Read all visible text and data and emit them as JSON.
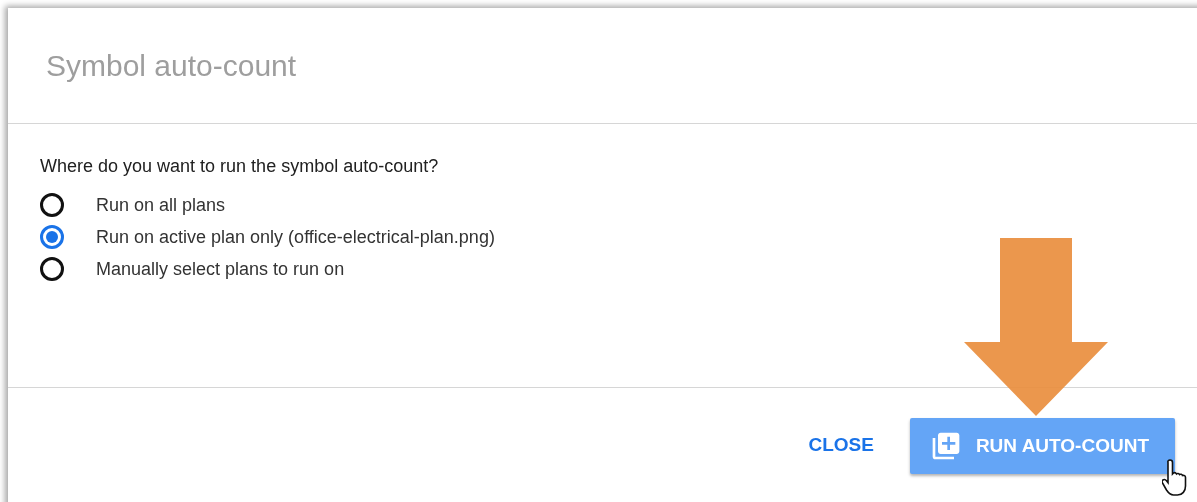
{
  "dialog": {
    "title": "Symbol auto-count",
    "question": "Where do you want to run the symbol auto-count?",
    "options": [
      {
        "label": "Run on all plans",
        "selected": false
      },
      {
        "label": "Run on active plan only (office-electrical-plan.png)",
        "selected": true
      },
      {
        "label": "Manually select plans to run on",
        "selected": false
      }
    ],
    "buttons": [
      {
        "kind": "text",
        "label": "CLOSE"
      },
      {
        "kind": "primary",
        "label": "RUN AUTO-COUNT"
      }
    ]
  }
}
